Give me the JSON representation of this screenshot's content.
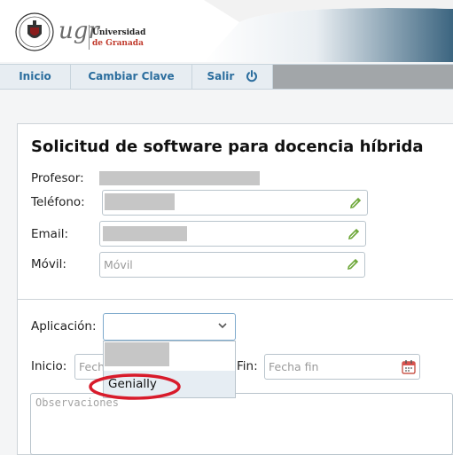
{
  "header": {
    "logo_text": "ugr",
    "university_line1": "Universidad",
    "university_line2": "de Granada"
  },
  "nav": {
    "items": [
      {
        "label": "Inicio"
      },
      {
        "label": "Cambiar Clave"
      },
      {
        "label": "Salir"
      }
    ]
  },
  "form": {
    "title": "Solicitud de software para docencia híbrida",
    "labels": {
      "profesor": "Profesor:",
      "telefono": "Teléfono:",
      "email": "Email:",
      "movil": "Móvil:",
      "aplicacion": "Aplicación:",
      "inicio": "Inicio:",
      "fin": "Fin:"
    },
    "placeholders": {
      "movil": "Móvil",
      "inicio": "Fecha inicio",
      "fin": "Fecha fin",
      "observaciones": "Observaciones"
    },
    "dropdown_options": [
      "Genially"
    ],
    "selected_value": ""
  },
  "colors": {
    "accent": "#2c6e9e",
    "highlight": "#d81b2b",
    "pencil": "#6ea83a"
  }
}
